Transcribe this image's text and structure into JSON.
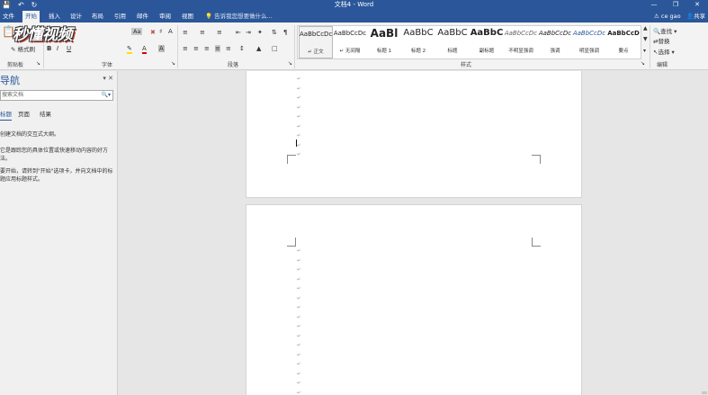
{
  "window": {
    "title": "文档4 - Word",
    "qat_icons": [
      "save-icon",
      "undo-icon",
      "redo-icon"
    ],
    "controls": [
      "minimize-icon",
      "restore-icon",
      "close-icon"
    ]
  },
  "tabs": [
    {
      "label": "文件"
    },
    {
      "label": "开始",
      "active": true
    },
    {
      "label": "插入"
    },
    {
      "label": "设计"
    },
    {
      "label": "布局"
    },
    {
      "label": "引用"
    },
    {
      "label": "邮件"
    },
    {
      "label": "审阅"
    },
    {
      "label": "视图"
    }
  ],
  "tell_me": "告诉我您想要做什么...",
  "user": {
    "name": "ce gao",
    "share": "共享"
  },
  "logo_text": "秒懂视频",
  "ribbon": {
    "clipboard": {
      "label": "剪贴板",
      "format_painter": "格式刷"
    },
    "font": {
      "label": "字体",
      "bold": "B",
      "italic": "I",
      "underline": "U",
      "case_btn": "Aa"
    },
    "paragraph": {
      "label": "段落"
    },
    "styles": {
      "label": "样式",
      "items": [
        {
          "sample": "AaBbCcDc",
          "name": "↵ 正文",
          "selected": true
        },
        {
          "sample": "AaBbCcDc",
          "name": "↵ 无间隔"
        },
        {
          "sample": "AaBl",
          "name": "标题 1"
        },
        {
          "sample": "AaBbC",
          "name": "标题 2"
        },
        {
          "sample": "AaBbC",
          "name": "标题"
        },
        {
          "sample": "AaBbC",
          "name": "副标题"
        },
        {
          "sample": "AaBbCcDc",
          "name": "不明显强调"
        },
        {
          "sample": "AaBbCcDc",
          "name": "强调"
        },
        {
          "sample": "AaBbCcDc",
          "name": "明显强调"
        },
        {
          "sample": "AaBbCcD",
          "name": "要点"
        }
      ]
    },
    "editing": {
      "label": "编辑",
      "find": "查找",
      "replace": "替换",
      "select": "选择"
    }
  },
  "nav": {
    "title": "导航",
    "search_placeholder": "搜索文档",
    "tabs": [
      "标题",
      "页面",
      "结果"
    ],
    "msg1": "创建文档的交互式大纲。",
    "msg2": "它是跟踪您的具体位置或快速移动内容的好方法。",
    "msg3": "要开始，请转到\"开始\"选项卡，并向文档中的标题应用标题样式。"
  },
  "doc": {
    "para_mark": "↵"
  }
}
